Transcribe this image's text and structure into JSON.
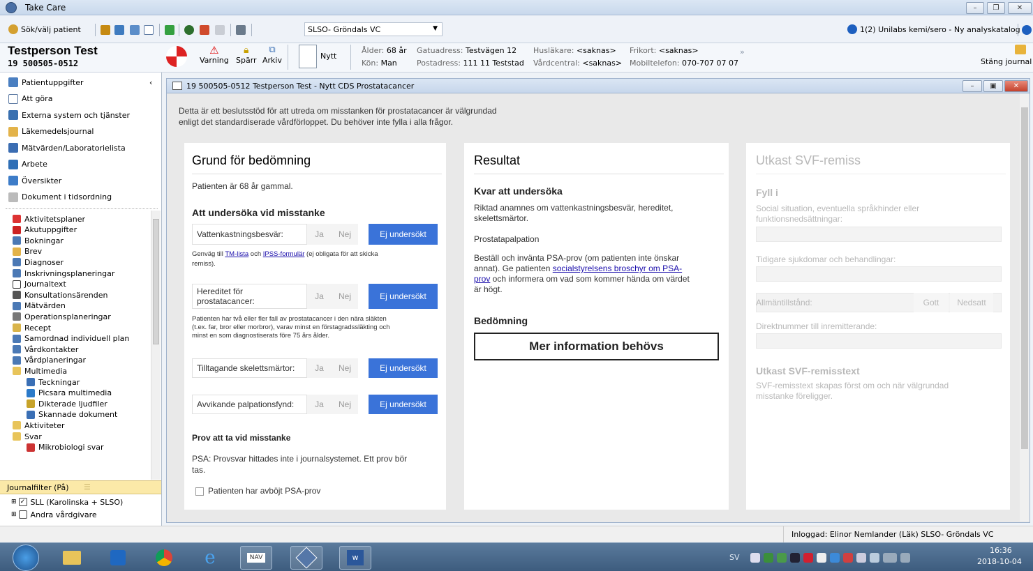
{
  "window": {
    "title": "Take Care"
  },
  "toolbar": {
    "search_patient": "Sök/välj patient",
    "unit_select": "SLSO- Gröndals VC",
    "notification": "1(2) Unilabs kemi/sero - Ny analyskatalog"
  },
  "patient": {
    "name": "Testperson Test",
    "id": "19 500505-0512",
    "actions": {
      "varning": "Varning",
      "sparr": "Spärr",
      "arkiv": "Arkiv",
      "nytt": "Nytt"
    },
    "info": {
      "age_label": "Ålder:",
      "age": "68 år",
      "sex_label": "Kön:",
      "sex": "Man",
      "street_label": "Gatuadress:",
      "street": "Testvägen 12",
      "postal_label": "Postadress:",
      "postal": "111 11 Teststad",
      "doctor_label": "Husläkare:",
      "doctor": "<saknas>",
      "center_label": "Vårdcentral:",
      "center": "<saknas>",
      "frikort_label": "Frikort:",
      "frikort": "<saknas>",
      "mobile_label": "Mobiltelefon:",
      "mobile": "070-707 07 07"
    },
    "close_record": "Stäng journal"
  },
  "sidebar": {
    "top_items": [
      {
        "label": "Patientuppgifter",
        "icon": "person-icon"
      },
      {
        "label": "Att göra",
        "icon": "checkbox-icon"
      },
      {
        "label": "Externa system och tjänster",
        "icon": "network-icon"
      },
      {
        "label": "Läkemedelsjournal",
        "icon": "medicine-icon"
      },
      {
        "label": "Mätvärden/Laboratorielista",
        "icon": "chart-icon"
      },
      {
        "label": "Arbete",
        "icon": "work-icon"
      },
      {
        "label": "Översikter",
        "icon": "grid-icon"
      },
      {
        "label": "Dokument i tidsordning",
        "icon": "clock-icon"
      }
    ],
    "tree_items": [
      "Aktivitetsplaner",
      "Akutuppgifter",
      "Bokningar",
      "Brev",
      "Diagnoser",
      "Inskrivningsplaneringar",
      "Journaltext",
      "Konsultationsärenden",
      "Mätvärden",
      "Operationsplaneringar",
      "Recept",
      "Samordnad individuell plan",
      "Vårdkontakter",
      "Vårdplaneringar",
      "Multimedia"
    ],
    "multimedia_children": [
      "Teckningar",
      "Picsara multimedia",
      "Dikterade ljudfiler",
      "Skannade dokument"
    ],
    "after_items": [
      "Aktiviteter",
      "Svar"
    ],
    "svar_children": [
      "Mikrobiologi svar"
    ],
    "filter_label": "Journalfilter (På)",
    "caregivers": [
      "SLL (Karolinska + SLSO)",
      "Andra vårdgivare"
    ]
  },
  "doc": {
    "title": "19 500505-0512 Testperson Test - Nytt CDS Prostatacancer",
    "intro_line1": "Detta är ett beslutsstöd för att utreda om misstanken för prostatacancer är välgrundad",
    "intro_line2": "enligt det standardiserade vårdförloppet. Du behöver inte fylla i alla frågor."
  },
  "grund": {
    "title": "Grund för bedömning",
    "age_text": "Patienten är 68 år gammal.",
    "section": "Att undersöka vid misstanke",
    "buttons": {
      "ja": "Ja",
      "nej": "Nej",
      "ej": "Ej undersökt"
    },
    "q1": "Vattenkastningsbesvär:",
    "q1_note_a": "Genväg till ",
    "q1_link1": "TM-lista",
    "q1_note_b": " och ",
    "q1_link2": "IPSS-formulär",
    "q1_note_c": " (ej obligata för att skicka",
    "q1_note_d": "remiss).",
    "q2_line1": "Hereditet för",
    "q2_line2": "prostatacancer:",
    "q2_note1": "Patienten har två eller fler fall av prostatacancer i den nära släkten",
    "q2_note2": "(t.ex. far, bror eller morbror), varav minst en förstagradssläkting och",
    "q2_note3": "minst en som diagnostiserats före 75 års ålder.",
    "q3": "Tilltagande skelettsmärtor:",
    "q4": "Avvikande palpationsfynd:",
    "prov_title": "Prov att ta vid misstanke",
    "psa_line1": "PSA: Provsvar hittades inte i journalsystemet. Ett prov bör",
    "psa_line2": "tas.",
    "declined": "Patienten har avböjt PSA-prov"
  },
  "resultat": {
    "title": "Resultat",
    "kvar_title": "Kvar att undersöka",
    "kvar_line1": "Riktad anamnes om vattenkastningsbesvär, hereditet,",
    "kvar_line2": "skelettsmärtor.",
    "palp": "Prostatapalpation",
    "psa_line1": "Beställ och invänta PSA-prov (om patienten inte önskar",
    "psa_line2a": "annat). Ge patienten ",
    "psa_link1": "socialstyrelsens broschyr om PSA-",
    "psa_link2": "prov",
    "psa_line3b": " och informera om vad som kommer hända om värdet",
    "psa_line4": "är högt.",
    "bedomning_title": "Bedömning",
    "bedomning_value": "Mer information behövs"
  },
  "utkast": {
    "title": "Utkast SVF-remiss",
    "fyll": "Fyll i",
    "social_line1": "Social situation, eventuella språkhinder eller",
    "social_line2": "funktionsnedsättningar:",
    "tidigare": "Tidigare sjukdomar och behandlingar:",
    "allman": "Allmäntillstånd:",
    "gott": "Gott",
    "nedsatt": "Nedsatt",
    "direkt": "Direktnummer till inremitterande:",
    "remisstext_title": "Utkast SVF-remisstext",
    "remisstext_line1": "SVF-remisstext skapas först om och när välgrundad",
    "remisstext_line2": "misstanke föreligger."
  },
  "status": {
    "logged_in": "Inloggad: Elinor Nemlander (Läk) SLSO- Gröndals VC"
  },
  "taskbar": {
    "lang": "SV",
    "time": "16:36",
    "date": "2018-10-04",
    "nav_label": "NAV"
  }
}
